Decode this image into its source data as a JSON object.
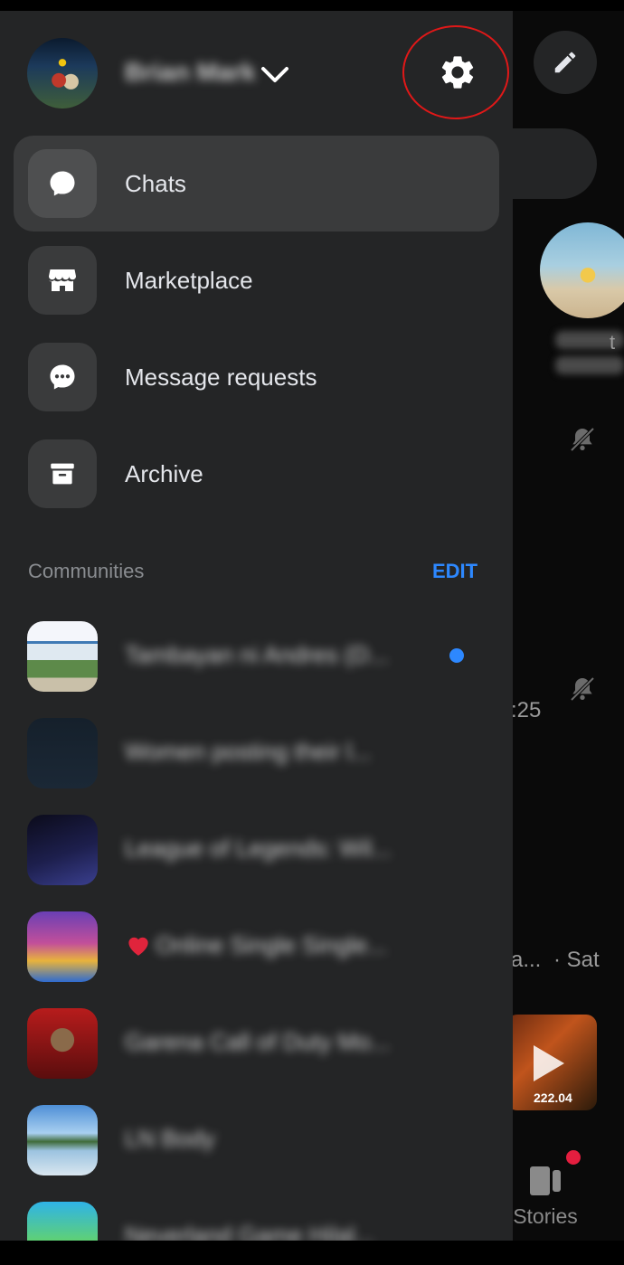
{
  "profile": {
    "name": "Brian Mark"
  },
  "nav": {
    "items": [
      {
        "label": "Chats",
        "icon": "chat-bubble-icon",
        "active": true
      },
      {
        "label": "Marketplace",
        "icon": "storefront-icon",
        "active": false
      },
      {
        "label": "Message requests",
        "icon": "message-dots-icon",
        "active": false
      },
      {
        "label": "Archive",
        "icon": "archive-box-icon",
        "active": false
      }
    ]
  },
  "communities": {
    "title": "Communities",
    "edit_label": "EDIT",
    "items": [
      {
        "name": "Tambayan ni Andres (D...",
        "unread": true
      },
      {
        "name": "Women posting their l...",
        "unread": false
      },
      {
        "name": "League of Legends: Wil...",
        "unread": false
      },
      {
        "name": "Online Single Single...",
        "unread": false
      },
      {
        "name": "Garena Call of Duty Mo...",
        "unread": false
      },
      {
        "name": "LN Body",
        "unread": false
      },
      {
        "name": "Neverland Game Hilal...",
        "unread": false
      }
    ]
  },
  "background": {
    "contact_letter": "t",
    "time_1": ":25",
    "time_2_prefix": "a...",
    "time_2": "· Sat",
    "video_price": "222.04",
    "stories_label": "Stories"
  },
  "colors": {
    "drawer_bg": "#242526",
    "active_item_bg": "#3a3b3c",
    "accent": "#2d88ff",
    "annotation": "#e01818"
  }
}
